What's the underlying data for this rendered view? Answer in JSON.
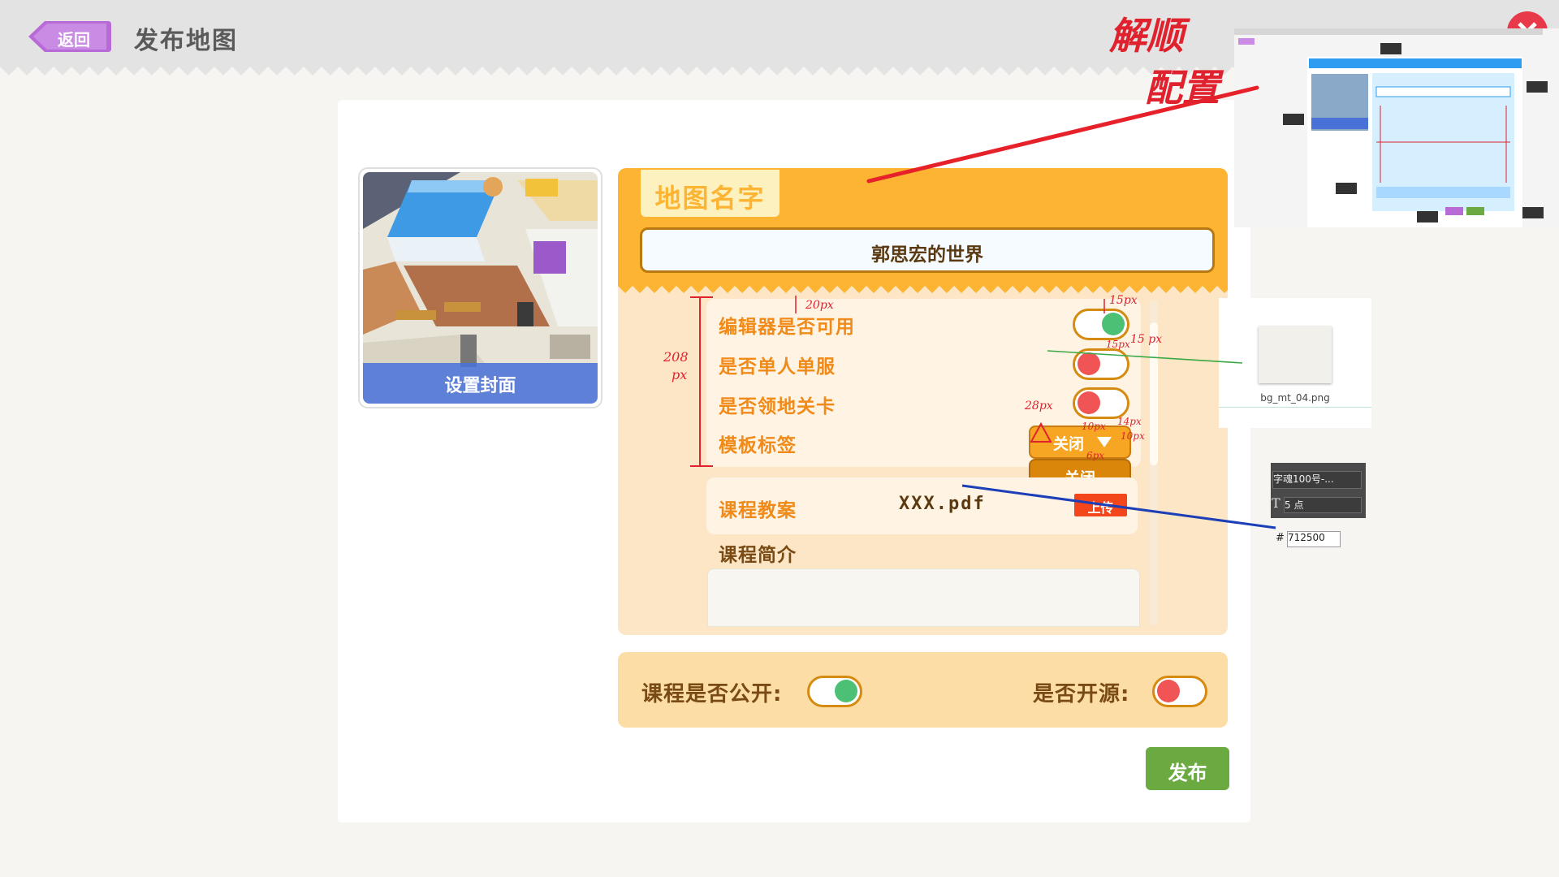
{
  "header": {
    "back_label": "返回",
    "title": "发布地图"
  },
  "cover": {
    "label": "设置封面"
  },
  "map": {
    "name_tab": "地图名字",
    "name_value": "郭思宏的世界"
  },
  "settings": {
    "rows": [
      {
        "label": "编辑器是否可用",
        "state": "on"
      },
      {
        "label": "是否单人单服",
        "state": "off"
      },
      {
        "label": "是否领地关卡",
        "state": "off"
      },
      {
        "label": "模板标签"
      }
    ],
    "dropdown_value": "关闭",
    "dropdown_option": "关闭"
  },
  "lesson": {
    "plan_label": "课程教案",
    "file_name": "XXX.pdf",
    "upload_label": "上传",
    "intro_label": "课程简介"
  },
  "footer_options": {
    "public_label": "课程是否公开:",
    "public_state": "on",
    "opensource_label": "是否开源:",
    "opensource_state": "off"
  },
  "publish_label": "发布",
  "assets": {
    "file_name": "bg_mt_04.png"
  },
  "ps_panel": {
    "font": "字魂100号-...",
    "size": "5 点",
    "color_hex": "712500"
  },
  "annotations": {
    "note_line1": "解顺",
    "note_line2": "配置",
    "dim_208": "208",
    "dim_px": "px",
    "dim_20": "20px",
    "dim_15a": "15px",
    "dim_15b": "15px",
    "dim_15c": "15 px",
    "dim_28": "28px",
    "dim_10a": "10px",
    "dim_14": "14px",
    "dim_10b": "10px",
    "dim_6": "6px"
  },
  "colors": {
    "orange": "#fdb433",
    "panel": "#fde6c6",
    "label_orange": "#f08a19",
    "brown_text": "#5b3a12",
    "toggle_on": "#4cc176",
    "toggle_off": "#f05454",
    "publish_green": "#6aaa41",
    "back_purple": "#c77be0"
  }
}
